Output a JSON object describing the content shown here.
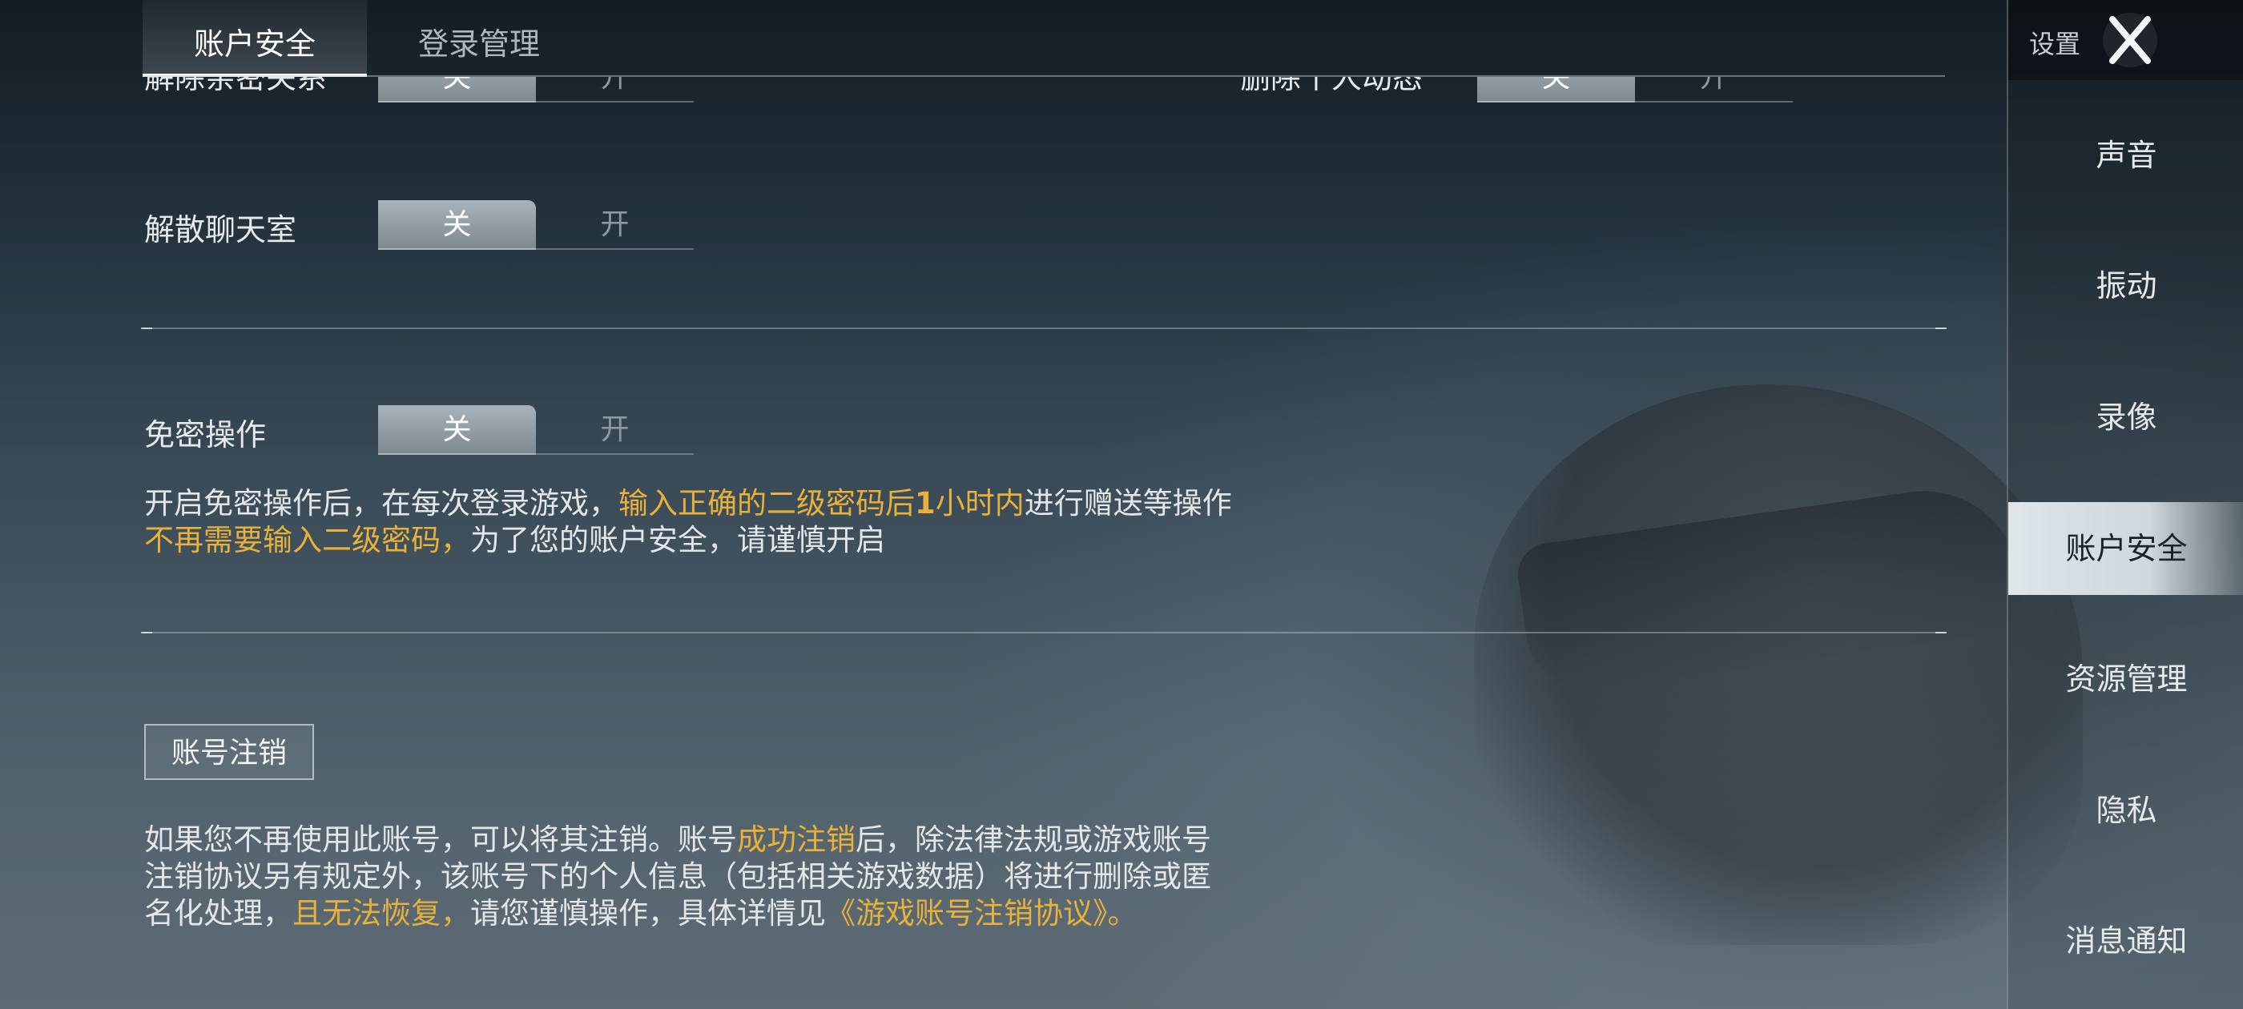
{
  "tabs": [
    {
      "label": "账户安全",
      "active": true
    },
    {
      "label": "登录管理",
      "active": false
    }
  ],
  "settings": {
    "clipped_left_label": "解除亲密关系",
    "clipped_right_label": "删除个人动态",
    "dissolve_chat_label": "解散聊天室",
    "password_free_label": "免密操作",
    "toggle_off": "关",
    "toggle_on": "开"
  },
  "password_free_desc": {
    "line1_part1": "开启免密操作后，在每次登录游戏，",
    "line1_highlight": "输入正确的二级密码后",
    "line1_bold": "1",
    "line1_highlight2": "小时内",
    "line1_part2": "进行赠送等操作",
    "line2_highlight": "不再需要输入二级密码，",
    "line2_part": "为了您的账户安全，请谨慎开启"
  },
  "account_cancel": {
    "button_label": "账号注销",
    "line1_part1": "如果您不再使用此账号，可以将其注销。账号",
    "line1_highlight": "成功注销",
    "line1_part2": "后，除法律法规或游戏账号",
    "line2": "注销协议另有规定外，该账号下的个人信息（包括相关游戏数据）将进行删除或匿",
    "line3_part1": "名化处理，",
    "line3_highlight": "且无法恢复，",
    "line3_part2": "请您谨慎操作，具体详情见",
    "line3_link": "《游戏账号注销协议》。"
  },
  "sidebar": {
    "title": "设置",
    "close_icon": "close-x-icon",
    "items": [
      {
        "label": "声音",
        "active": false
      },
      {
        "label": "振动",
        "active": false
      },
      {
        "label": "录像",
        "active": false
      },
      {
        "label": "账户安全",
        "active": true
      },
      {
        "label": "资源管理",
        "active": false
      },
      {
        "label": "隐私",
        "active": false
      },
      {
        "label": "消息通知",
        "active": false
      }
    ]
  },
  "colors": {
    "highlight": "#e8b23a",
    "active_tab_underline": "#f2f4f6",
    "sidebar_active_bg": "#dfe5e9"
  }
}
